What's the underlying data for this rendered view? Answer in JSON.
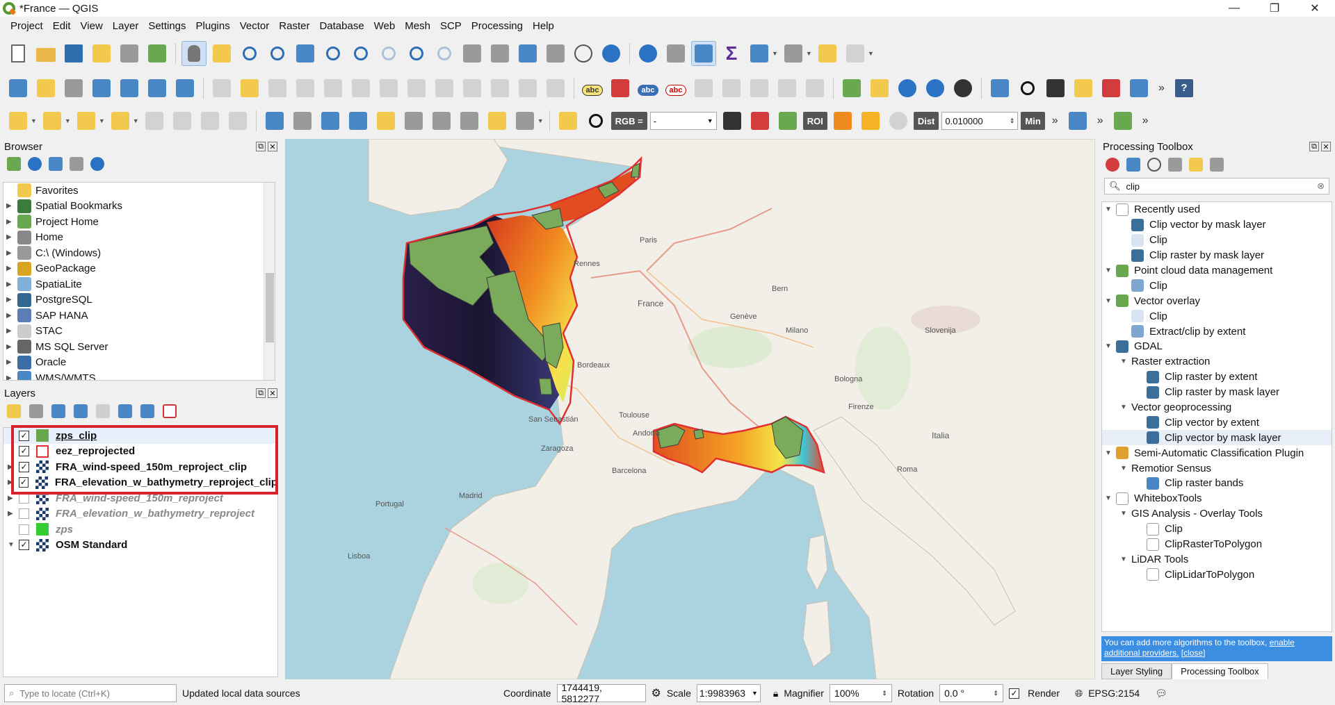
{
  "window": {
    "title": "*France — QGIS"
  },
  "menu": [
    "Project",
    "Edit",
    "View",
    "Layer",
    "Settings",
    "Plugins",
    "Vector",
    "Raster",
    "Database",
    "Web",
    "Mesh",
    "SCP",
    "Processing",
    "Help"
  ],
  "toolbar": {
    "abc_label": "abc",
    "rgb_label": "RGB =",
    "rgb_value": "-",
    "roi_label": "ROI",
    "dist_label": "Dist",
    "dist_value": "0.010000",
    "min_label": "Min"
  },
  "browser": {
    "title": "Browser",
    "items": [
      {
        "label": "Favorites",
        "icon": "star-icon",
        "color": "#f2c94c"
      },
      {
        "label": "Spatial Bookmarks",
        "icon": "bookmark-icon",
        "color": "#3d7b3a"
      },
      {
        "label": "Project Home",
        "icon": "project-home-icon",
        "color": "#6aa84f"
      },
      {
        "label": "Home",
        "icon": "home-icon",
        "color": "#888888"
      },
      {
        "label": "C:\\ (Windows)",
        "icon": "drive-icon",
        "color": "#999999"
      },
      {
        "label": "GeoPackage",
        "icon": "geopackage-icon",
        "color": "#d9a520"
      },
      {
        "label": "SpatiaLite",
        "icon": "spatialite-icon",
        "color": "#7fb0d9"
      },
      {
        "label": "PostgreSQL",
        "icon": "postgresql-icon",
        "color": "#336791"
      },
      {
        "label": "SAP HANA",
        "icon": "sap-hana-icon",
        "color": "#5b7fb5"
      },
      {
        "label": "STAC",
        "icon": "stac-icon",
        "color": "#cccccc"
      },
      {
        "label": "MS SQL Server",
        "icon": "mssql-icon",
        "color": "#666666"
      },
      {
        "label": "Oracle",
        "icon": "oracle-icon",
        "color": "#3a6ea5"
      },
      {
        "label": "WMS/WMTS",
        "icon": "wms-icon",
        "color": "#4a87c5"
      }
    ]
  },
  "layers": {
    "title": "Layers",
    "items": [
      {
        "name": "zps_clip",
        "checked": "✓",
        "swatch": "#6aa84f",
        "type": "vector"
      },
      {
        "name": "eez_reprojected",
        "checked": "✓",
        "swatch": "#ffffff",
        "type": "vector-outline"
      },
      {
        "name": "FRA_wind-speed_150m_reproject_clip",
        "checked": "✓",
        "type": "raster"
      },
      {
        "name": "FRA_elevation_w_bathymetry_reproject_clip",
        "checked": "✓",
        "type": "raster"
      },
      {
        "name": "FRA_wind-speed_150m_reproject",
        "checked": "",
        "type": "raster"
      },
      {
        "name": "FRA_elevation_w_bathymetry_reproject",
        "checked": "",
        "type": "raster"
      },
      {
        "name": "zps",
        "checked": "",
        "swatch": "#33cc33",
        "type": "vector"
      },
      {
        "name": "OSM Standard",
        "checked": "✓",
        "type": "raster"
      }
    ]
  },
  "map": {
    "labels": [
      "Rennes",
      "Paris",
      "France",
      "Toulouse",
      "Bologna",
      "Andorra",
      "Zaragoza",
      "Barcelona",
      "Madrid",
      "Portugal",
      "Lisboa",
      "Genève",
      "Milano",
      "Firenze",
      "Roma",
      "Italia",
      "Bern",
      "Slovenija",
      "Bordeaux",
      "San Sebastián"
    ],
    "colors": {
      "water": "#aad3df",
      "land": "#f2efe9",
      "eez_outline": "#e03030",
      "zps_fill": "#7aab5a"
    }
  },
  "processing": {
    "title": "Processing Toolbox",
    "search_value": "clip",
    "tree": [
      {
        "label": "Recently used",
        "level": 0,
        "exp": "▼",
        "icon": "clock-icon",
        "color": "#ffffff"
      },
      {
        "label": "Clip vector by mask layer",
        "level": 1,
        "exp": "",
        "icon": "gdal-icon",
        "color": "#3c6e9c"
      },
      {
        "label": "Clip",
        "level": 1,
        "exp": "",
        "icon": "algorithm-icon",
        "color": "#d8e4ef"
      },
      {
        "label": "Clip raster by mask layer",
        "level": 1,
        "exp": "",
        "icon": "gdal-icon",
        "color": "#3c6e9c"
      },
      {
        "label": "Point cloud data management",
        "level": 0,
        "exp": "▼",
        "icon": "qgis-icon",
        "color": "#6aa84f"
      },
      {
        "label": "Clip",
        "level": 1,
        "exp": "",
        "icon": "gear-icon",
        "color": "#7fa6cf"
      },
      {
        "label": "Vector overlay",
        "level": 0,
        "exp": "▼",
        "icon": "qgis-icon",
        "color": "#6aa84f"
      },
      {
        "label": "Clip",
        "level": 1,
        "exp": "",
        "icon": "algorithm-icon",
        "color": "#d8e4ef"
      },
      {
        "label": "Extract/clip by extent",
        "level": 1,
        "exp": "",
        "icon": "gear-icon",
        "color": "#7fa6cf"
      },
      {
        "label": "GDAL",
        "level": 0,
        "exp": "▼",
        "icon": "gdal-icon",
        "color": "#3c6e9c"
      },
      {
        "label": "Raster extraction",
        "level": 1,
        "exp": "▼",
        "icon": "",
        "color": ""
      },
      {
        "label": "Clip raster by extent",
        "level": 2,
        "exp": "",
        "icon": "gdal-icon",
        "color": "#3c6e9c"
      },
      {
        "label": "Clip raster by mask layer",
        "level": 2,
        "exp": "",
        "icon": "gdal-icon",
        "color": "#3c6e9c"
      },
      {
        "label": "Vector geoprocessing",
        "level": 1,
        "exp": "▼",
        "icon": "",
        "color": ""
      },
      {
        "label": "Clip vector by extent",
        "level": 2,
        "exp": "",
        "icon": "gdal-icon",
        "color": "#3c6e9c"
      },
      {
        "label": "Clip vector by mask layer",
        "level": 2,
        "exp": "",
        "icon": "gdal-icon",
        "color": "#3c6e9c",
        "selected": true
      },
      {
        "label": "Semi-Automatic Classification Plugin",
        "level": 0,
        "exp": "▼",
        "icon": "scp-icon",
        "color": "#e0a030"
      },
      {
        "label": "Remotior Sensus",
        "level": 1,
        "exp": "▼",
        "icon": "",
        "color": ""
      },
      {
        "label": "Clip raster bands",
        "level": 2,
        "exp": "",
        "icon": "scp-tool-icon",
        "color": "#4a87c5"
      },
      {
        "label": "WhiteboxTools",
        "level": 0,
        "exp": "▼",
        "icon": "whitebox-icon",
        "color": "#ffffff"
      },
      {
        "label": "GIS Analysis - Overlay Tools",
        "level": 1,
        "exp": "▼",
        "icon": "",
        "color": ""
      },
      {
        "label": "Clip",
        "level": 2,
        "exp": "",
        "icon": "whitebox-icon",
        "color": "#ffffff"
      },
      {
        "label": "ClipRasterToPolygon",
        "level": 2,
        "exp": "",
        "icon": "whitebox-icon",
        "color": "#ffffff"
      },
      {
        "label": "LiDAR Tools",
        "level": 1,
        "exp": "▼",
        "icon": "",
        "color": ""
      },
      {
        "label": "ClipLidarToPolygon",
        "level": 2,
        "exp": "",
        "icon": "whitebox-icon",
        "color": "#ffffff"
      }
    ],
    "info_text": "You can add more algorithms to the toolbox,",
    "info_link": "enable additional providers.",
    "info_close": "[close]",
    "tabs": [
      "Layer Styling",
      "Processing Toolbox"
    ]
  },
  "status": {
    "locator_placeholder": "Type to locate (Ctrl+K)",
    "message": "Updated local data sources",
    "coordinate_label": "Coordinate",
    "coordinate_value": "1744419, 5812277",
    "scale_label": "Scale",
    "scale_value": "1:9983963",
    "magnifier_label": "Magnifier",
    "magnifier_value": "100%",
    "rotation_label": "Rotation",
    "rotation_value": "0.0 °",
    "render_label": "Render",
    "crs_label": "EPSG:2154"
  }
}
